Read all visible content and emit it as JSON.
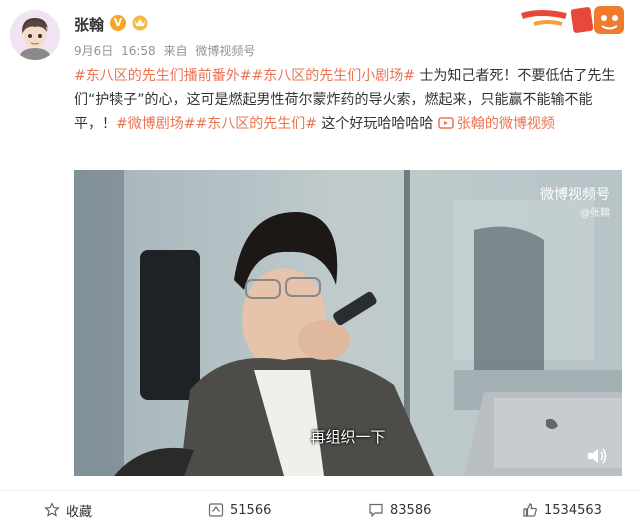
{
  "user": {
    "name": "张翰",
    "verified_mark": "V",
    "date": "9月6日",
    "time": "16:58",
    "source_prefix": "来自",
    "source": "微博视频号"
  },
  "post": {
    "tag1": "#东八区的先生们播前番外#",
    "tag2": "#东八区的先生们小剧场#",
    "text1": " 士为知己者死！不要低估了先生们“护犊子”的心，这可是燃起男性荷尔蒙炸药的导火索，燃起来，只能赢不能输不能平，！",
    "tag3": "#微博剧场#",
    "tag4": "#东八区的先生们#",
    "text2": " 这个好玩哈哈哈哈 ",
    "link_icon": "video-link-icon",
    "link_text": "张翰的微博视频"
  },
  "video": {
    "subtitle": "再组织一下",
    "watermark_title": "微博视频号",
    "watermark_user": "@张翰"
  },
  "actions": {
    "favorite": "收藏",
    "repost_count": "51566",
    "comment_count": "83586",
    "like_count": "1534563"
  },
  "colors": {
    "accent": "#eb7350",
    "meta": "#939393",
    "badge": "#f5a623"
  }
}
